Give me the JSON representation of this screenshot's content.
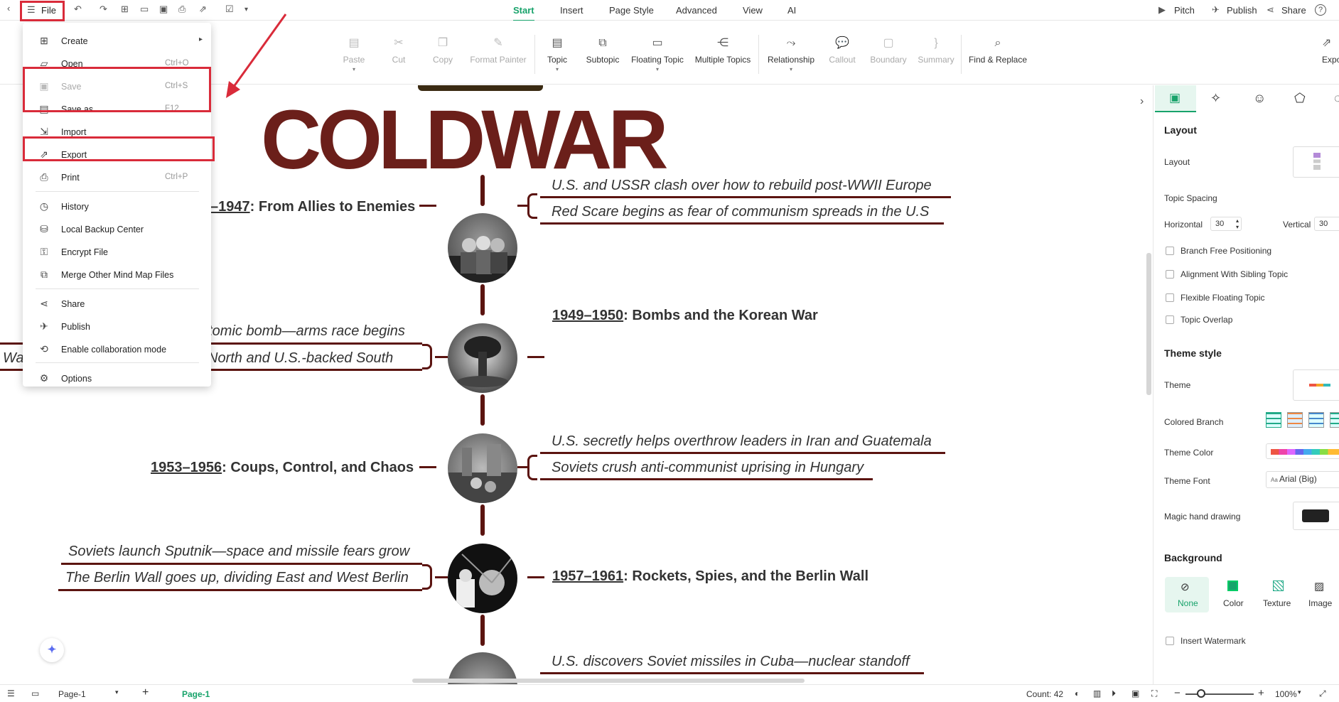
{
  "topbar": {
    "file_label": "File",
    "tabs": [
      "Start",
      "Insert",
      "Page Style",
      "Advanced",
      "View",
      "AI"
    ],
    "active_tab": "Start",
    "pitch_label": "Pitch",
    "publish_label": "Publish",
    "share_label": "Share",
    "help_label": "?"
  },
  "ribbon": {
    "paste": "Paste",
    "cut": "Cut",
    "copy": "Copy",
    "format_painter": "Format Painter",
    "topic": "Topic",
    "subtopic": "Subtopic",
    "floating_topic": "Floating Topic",
    "multiple_topics": "Multiple Topics",
    "relationship": "Relationship",
    "callout": "Callout",
    "boundary": "Boundary",
    "summary": "Summary",
    "find_replace": "Find & Replace",
    "export_partial": "Expo"
  },
  "file_menu": {
    "items": [
      {
        "label": "Create",
        "shortcut": "",
        "icon": "plus-square-icon"
      },
      {
        "label": "Open",
        "shortcut": "Ctrl+O",
        "icon": "folder-icon"
      },
      {
        "label": "Save",
        "shortcut": "Ctrl+S",
        "icon": "save-icon"
      },
      {
        "label": "Save as",
        "shortcut": "F12",
        "icon": "save-as-icon"
      },
      {
        "label": "Import",
        "shortcut": "",
        "icon": "import-icon"
      },
      {
        "label": "Export",
        "shortcut": "",
        "icon": "export-icon"
      },
      {
        "label": "Print",
        "shortcut": "Ctrl+P",
        "icon": "printer-icon"
      },
      {
        "label": "History",
        "shortcut": "",
        "icon": "clock-icon"
      },
      {
        "label": "Local Backup Center",
        "shortcut": "",
        "icon": "backup-icon"
      },
      {
        "label": "Encrypt File",
        "shortcut": "",
        "icon": "lock-icon"
      },
      {
        "label": "Merge Other Mind Map Files",
        "shortcut": "",
        "icon": "merge-icon"
      },
      {
        "label": "Share",
        "shortcut": "",
        "icon": "share-icon"
      },
      {
        "label": "Publish",
        "shortcut": "",
        "icon": "send-icon"
      },
      {
        "label": "Enable collaboration mode",
        "shortcut": "",
        "icon": "collaboration-icon"
      },
      {
        "label": "Options",
        "shortcut": "",
        "icon": "gear-icon"
      }
    ]
  },
  "canvas": {
    "title": "COLDWAR",
    "topics": [
      {
        "year": "–1947",
        "rest": ": From Allies to Enemies"
      },
      {
        "year": "1949–1950",
        "rest": ": Bombs and the Korean War"
      },
      {
        "year": "1953–1956",
        "rest": ": Coups, Control, and Chaos"
      },
      {
        "year": "1957–1961",
        "rest": ": Rockets, Spies, and the Berlin Wall"
      }
    ],
    "subs": {
      "t1a": "U.S. and USSR clash over how to rebuild post-WWII Europe",
      "t1b": "Red Scare begins as fear of communism spreads in the U.S",
      "t2a": "atomic bomb—arms race begins",
      "t2b": "North and U.S.-backed South",
      "t2c": "Wa",
      "t3a": "U.S. secretly helps overthrow leaders in Iran and Guatemala",
      "t3b": "Soviets crush anti-communist uprising in Hungary",
      "t4a": "Soviets launch Sputnik—space and missile fears grow",
      "t4b": "The Berlin Wall goes up, dividing East and West Berlin",
      "t5a": "U.S. discovers Soviet missiles in Cuba—nuclear standoff"
    }
  },
  "panel": {
    "layout_h": "Layout",
    "layout_lbl": "Layout",
    "topic_spacing": "Topic Spacing",
    "horizontal": "Horizontal",
    "horizontal_val": "30",
    "vertical": "Vertical",
    "vertical_val": "30",
    "chk1": "Branch Free Positioning",
    "chk2": "Alignment With Sibling Topic",
    "chk3": "Flexible Floating Topic",
    "chk4": "Topic Overlap",
    "theme_style": "Theme style",
    "theme": "Theme",
    "colored_branch": "Colored Branch",
    "theme_color": "Theme Color",
    "theme_font": "Theme Font",
    "theme_font_val": "Arial (Big)",
    "magic": "Magic hand drawing",
    "background": "Background",
    "bg_none": "None",
    "bg_color": "Color",
    "bg_texture": "Texture",
    "bg_image": "Image",
    "watermark": "Insert Watermark",
    "accent": "#18a36b"
  },
  "status": {
    "page_sel": "Page-1",
    "page_tab": "Page-1",
    "count": "Count: 42",
    "zoom": "100%"
  },
  "colors": {
    "highlight": "#d92b3a",
    "branch": "#5b1410",
    "title": "#6b1f1a"
  }
}
